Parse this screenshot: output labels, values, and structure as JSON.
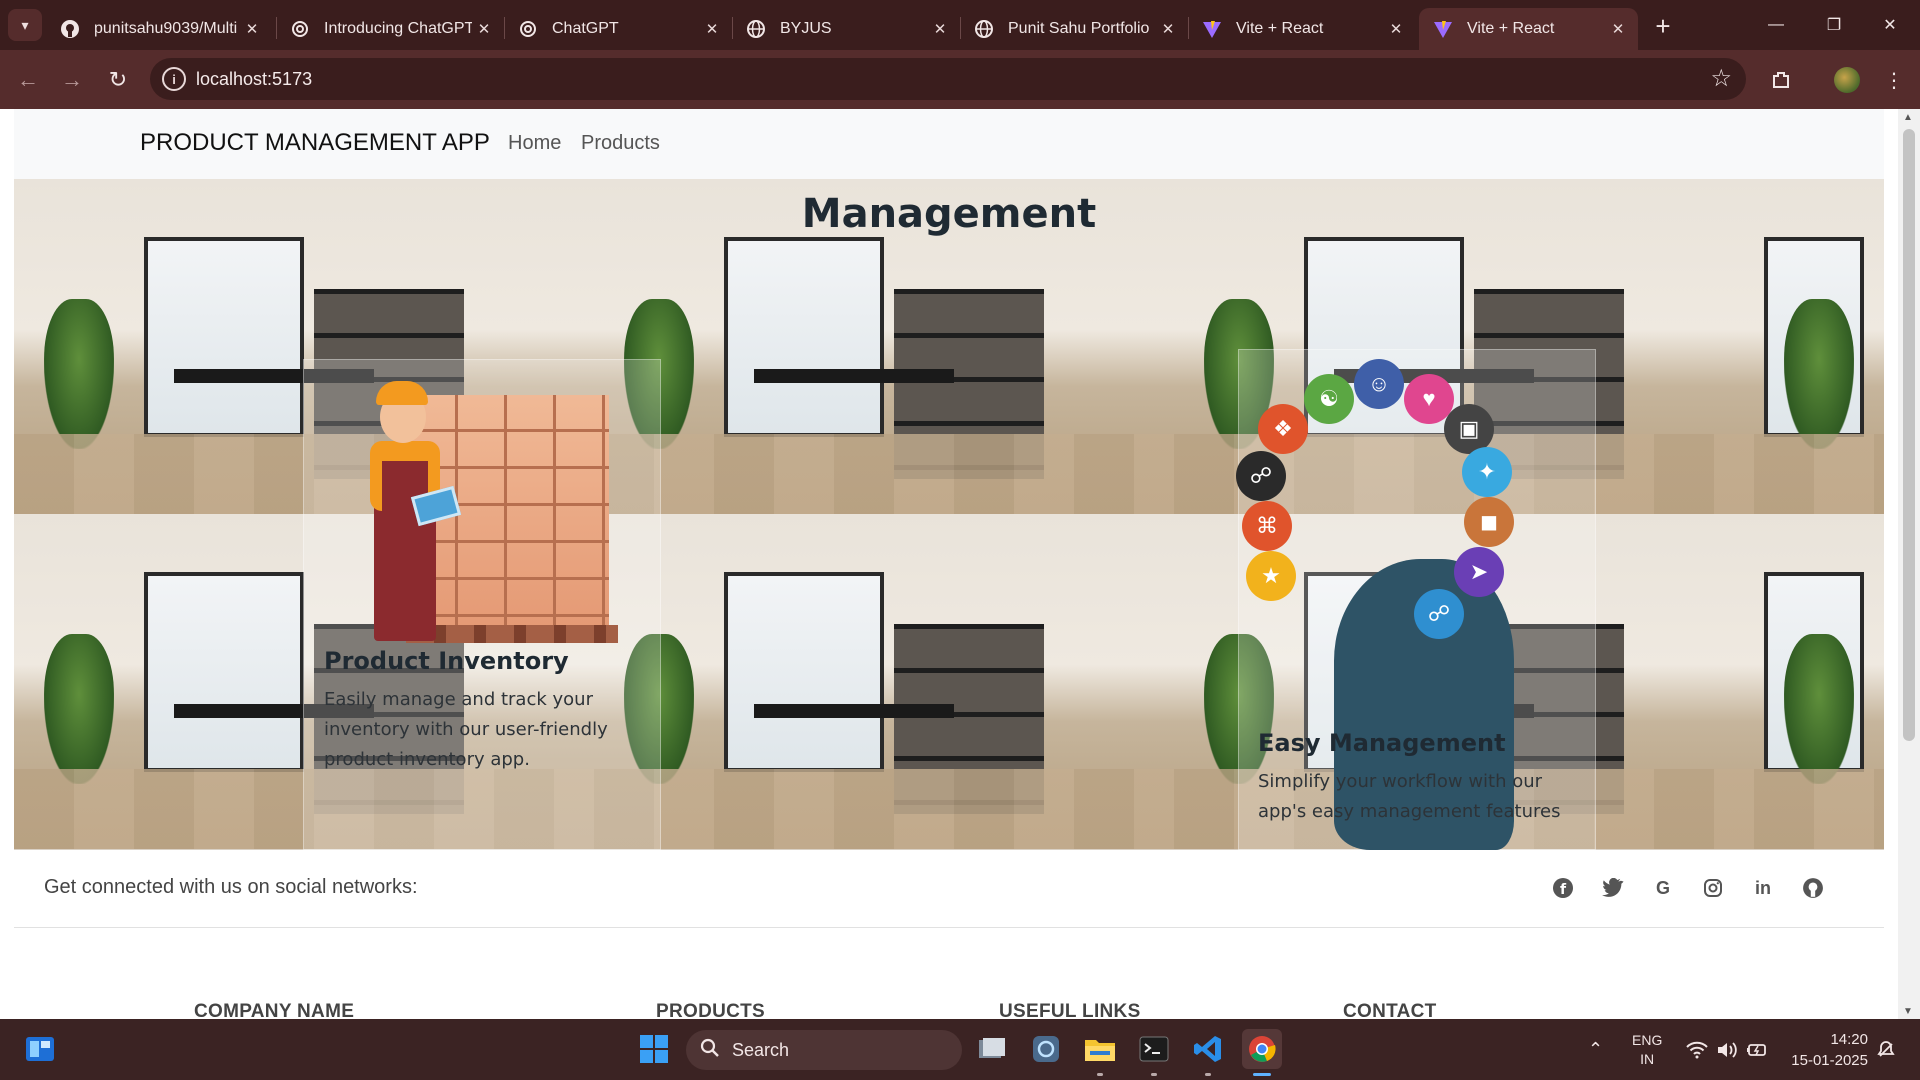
{
  "browser": {
    "tabs": [
      {
        "label": "punitsahu9039/Multi",
        "icon": "github-icon"
      },
      {
        "label": "Introducing ChatGPT",
        "icon": "openai-icon"
      },
      {
        "label": "ChatGPT",
        "icon": "openai-icon"
      },
      {
        "label": "BYJUS",
        "icon": "globe-icon"
      },
      {
        "label": "Punit Sahu Portfolio",
        "icon": "globe-icon"
      },
      {
        "label": "Vite + React",
        "icon": "vite-icon"
      },
      {
        "label": "Vite + React",
        "icon": "vite-icon",
        "active": true
      }
    ],
    "address": "localhost:5173"
  },
  "navbar": {
    "brand": "PRODUCT MANAGEMENT APP",
    "links": [
      "Home",
      "Products"
    ]
  },
  "hero": {
    "title": "Management",
    "cards": [
      {
        "title": "Product Inventory",
        "lines": [
          "Easily manage and track your",
          "inventory with our user-friendly",
          "product inventory app."
        ]
      },
      {
        "title": "Easy Management",
        "lines": [
          "Simplify your workflow with our",
          "app's easy management features"
        ]
      }
    ]
  },
  "footer": {
    "social_text": "Get connected with us on social networks:",
    "social_icons": [
      "facebook-icon",
      "twitter-icon",
      "google-icon",
      "instagram-icon",
      "linkedin-icon",
      "github-icon"
    ],
    "columns": [
      "COMPANY NAME",
      "PRODUCTS",
      "USEFUL LINKS",
      "CONTACT"
    ]
  },
  "taskbar": {
    "search_label": "Search",
    "lang_line1": "ENG",
    "lang_line2": "IN",
    "time": "14:20",
    "date": "15-01-2025"
  },
  "colors": {
    "chrome_dark": "#3a1d1d",
    "chrome_toolbar": "#552c2c",
    "taskbar": "#3b2323",
    "hero_title": "#1f2a33"
  }
}
